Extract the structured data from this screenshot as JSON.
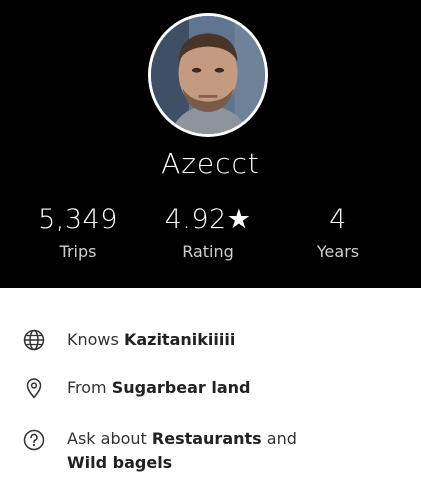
{
  "profile": {
    "name": "Azecct"
  },
  "stats": [
    {
      "value": "5,349",
      "label": "Trips"
    },
    {
      "value": "4.92★",
      "label": "Rating"
    },
    {
      "value": "4",
      "label": "Years"
    }
  ],
  "details": {
    "languages": {
      "prefix": "Knows ",
      "value": "Kazitanikiiiii"
    },
    "hometown": {
      "prefix": "From ",
      "value": "Sugarbear land"
    },
    "ask_about": {
      "prefix": "Ask about ",
      "topic1": "Restaurants",
      "joiner": " and",
      "topic2": "Wild bagels"
    }
  },
  "icons": {
    "languages": "globe-icon",
    "hometown": "location-pin-icon",
    "ask_about": "question-circle-icon"
  },
  "colors": {
    "header_bg": "#000000",
    "header_text": "#ffffff",
    "body_bg": "#ffffff",
    "body_text": "#333333"
  }
}
